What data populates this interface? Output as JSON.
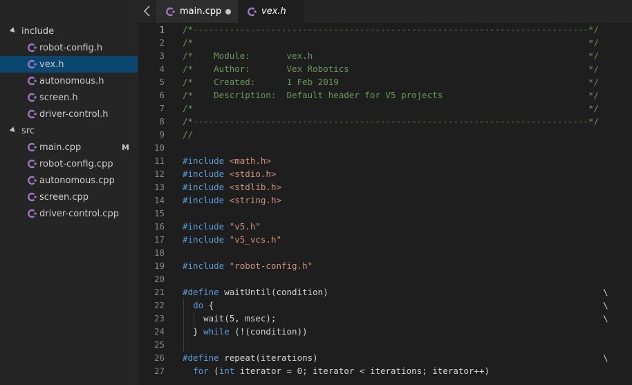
{
  "explorer": {
    "items": [
      {
        "type": "folder",
        "label": "include"
      },
      {
        "type": "file",
        "label": "robot-config.h"
      },
      {
        "type": "file",
        "label": "vex.h",
        "selected": true
      },
      {
        "type": "file",
        "label": "autonomous.h"
      },
      {
        "type": "file",
        "label": "screen.h"
      },
      {
        "type": "file",
        "label": "driver-control.h"
      },
      {
        "type": "folder",
        "label": "src"
      },
      {
        "type": "file",
        "label": "main.cpp",
        "badge": "M"
      },
      {
        "type": "file",
        "label": "robot-config.cpp"
      },
      {
        "type": "file",
        "label": "autonomous.cpp"
      },
      {
        "type": "file",
        "label": "screen.cpp"
      },
      {
        "type": "file",
        "label": "driver-control.cpp"
      }
    ]
  },
  "tabs": [
    {
      "label": "main.cpp",
      "modified": true
    },
    {
      "label": "vex.h",
      "active": true
    }
  ],
  "colors": {
    "comment": "#6a9955",
    "keyword": "#569cd6",
    "string": "#ce9178",
    "text": "#d4d4d4",
    "selection": "#094771",
    "icon": "#a074c4"
  },
  "icons": {
    "file": "cpp-file-icon",
    "back": "chevron-left-icon"
  },
  "editor": {
    "lines": [
      {
        "n": "1",
        "segs": [
          [
            "cmt",
            "/*----------------------------------------------------------------------------*/"
          ]
        ]
      },
      {
        "n": "2",
        "segs": [
          [
            "cmt",
            "/*                                                                            */"
          ]
        ]
      },
      {
        "n": "3",
        "segs": [
          [
            "cmt",
            "/*    Module:       vex.h                                                     */"
          ]
        ]
      },
      {
        "n": "4",
        "segs": [
          [
            "cmt",
            "/*    Author:       Vex Robotics                                              */"
          ]
        ]
      },
      {
        "n": "5",
        "segs": [
          [
            "cmt",
            "/*    Created:      1 Feb 2019                                                */"
          ]
        ]
      },
      {
        "n": "6",
        "segs": [
          [
            "cmt",
            "/*    Description:  Default header for V5 projects                            */"
          ]
        ]
      },
      {
        "n": "7",
        "segs": [
          [
            "cmt",
            "/*                                                                            */"
          ]
        ]
      },
      {
        "n": "8",
        "segs": [
          [
            "cmt",
            "/*----------------------------------------------------------------------------*/"
          ]
        ]
      },
      {
        "n": "9",
        "segs": [
          [
            "cmt",
            "//"
          ]
        ]
      },
      {
        "n": "10",
        "segs": []
      },
      {
        "n": "11",
        "segs": [
          [
            "inc",
            "#include "
          ],
          [
            "str",
            "<math.h>"
          ]
        ]
      },
      {
        "n": "12",
        "segs": [
          [
            "inc",
            "#include "
          ],
          [
            "str",
            "<stdio.h>"
          ]
        ]
      },
      {
        "n": "13",
        "segs": [
          [
            "inc",
            "#include "
          ],
          [
            "str",
            "<stdlib.h>"
          ]
        ]
      },
      {
        "n": "14",
        "segs": [
          [
            "inc",
            "#include "
          ],
          [
            "str",
            "<string.h>"
          ]
        ]
      },
      {
        "n": "15",
        "segs": []
      },
      {
        "n": "16",
        "segs": [
          [
            "inc",
            "#include "
          ],
          [
            "str",
            "\"v5.h\""
          ]
        ]
      },
      {
        "n": "17",
        "segs": [
          [
            "inc",
            "#include "
          ],
          [
            "str",
            "\"v5_vcs.h\""
          ]
        ]
      },
      {
        "n": "18",
        "segs": []
      },
      {
        "n": "19",
        "segs": [
          [
            "inc",
            "#include "
          ],
          [
            "str",
            "\"robot-config.h\""
          ]
        ]
      },
      {
        "n": "20",
        "segs": []
      },
      {
        "n": "21",
        "segs": [
          [
            "inc",
            "#define "
          ],
          [
            "pl",
            "waitUntil(condition)"
          ]
        ],
        "bs": "\\"
      },
      {
        "n": "22",
        "segs": [
          [
            "pl",
            "  "
          ],
          [
            "inc",
            "do"
          ],
          [
            "pl",
            " {"
          ]
        ],
        "bs": "\\"
      },
      {
        "n": "23",
        "segs": [
          [
            "pl",
            "    wait(5, msec);"
          ]
        ],
        "bs": "\\"
      },
      {
        "n": "24",
        "segs": [
          [
            "pl",
            "  } "
          ],
          [
            "inc",
            "while"
          ],
          [
            "pl",
            " (!(condition))"
          ]
        ]
      },
      {
        "n": "25",
        "segs": []
      },
      {
        "n": "26",
        "segs": [
          [
            "inc",
            "#define "
          ],
          [
            "pl",
            "repeat(iterations)"
          ]
        ],
        "bs": "\\"
      },
      {
        "n": "27",
        "segs": [
          [
            "pl",
            "  "
          ],
          [
            "inc",
            "for"
          ],
          [
            "pl",
            " ("
          ],
          [
            "inc",
            "int"
          ],
          [
            "pl",
            " iterator = 0; iterator < iterations; iterator++)"
          ]
        ]
      }
    ]
  }
}
